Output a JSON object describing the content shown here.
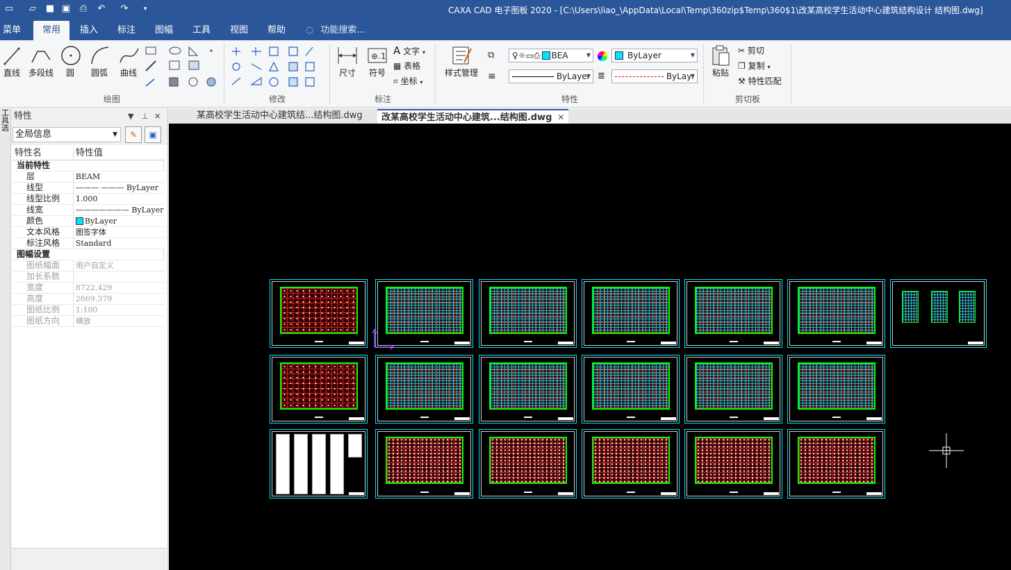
{
  "titlebar": {
    "title": "CAXA CAD 电子图板 2020 - [C:\\Users\\liao_\\AppData\\Local\\Temp\\360zip$Temp\\360$1\\改某高校学生活动中心建筑结构设计 结构图.dwg]"
  },
  "ribbon_tabs": [
    "菜单",
    "常用",
    "插入",
    "标注",
    "图幅",
    "工具",
    "视图",
    "帮助"
  ],
  "search_placeholder": "功能搜索...",
  "draw_group": {
    "label": "绘图",
    "buttons": [
      "直线",
      "多段线",
      "圆",
      "圆弧",
      "曲线"
    ]
  },
  "modify_group": {
    "label": "修改"
  },
  "annotate_group": {
    "label": "标注",
    "dimension": "尺寸",
    "symbol": "符号",
    "text": "文字",
    "table": "表格",
    "coord": "坐标"
  },
  "properties_group": {
    "label": "特性",
    "style_manager": "样式管理",
    "layer_value": "BEA",
    "color_value": "ByLayer",
    "linetype_value": "ByLayer",
    "linewidth_value": "ByLayı"
  },
  "clipboard_group": {
    "label": "剪切板",
    "paste": "粘贴",
    "cut": "剪切",
    "copy": "复制",
    "match": "特性匹配"
  },
  "left_strip": [
    "工",
    "具",
    "选",
    "项",
    "图",
    "层"
  ],
  "props_panel": {
    "title": "特性",
    "scope": "全局信息",
    "col_name": "特性名",
    "col_value": "特性值",
    "rows": [
      {
        "kind": "cat",
        "k": "当前特性",
        "v": ""
      },
      {
        "kind": "row",
        "k": "层",
        "v": "BEAM"
      },
      {
        "kind": "row",
        "k": "线型",
        "v": "——— ——— ByLayer"
      },
      {
        "kind": "row",
        "k": "线型比例",
        "v": "1.000"
      },
      {
        "kind": "row",
        "k": "线宽",
        "v": "——————— ByLayer"
      },
      {
        "kind": "row",
        "k": "颜色",
        "v": "ByLayer"
      },
      {
        "kind": "row",
        "k": "文本风格",
        "v": "图签字体"
      },
      {
        "kind": "row",
        "k": "标注风格",
        "v": "Standard"
      },
      {
        "kind": "cat",
        "k": "图幅设置",
        "v": ""
      },
      {
        "kind": "dim",
        "k": "图纸幅面",
        "v": "用户自定义"
      },
      {
        "kind": "dim",
        "k": "加长系数",
        "v": ""
      },
      {
        "kind": "dim",
        "k": "宽度",
        "v": "8722.429"
      },
      {
        "kind": "dim",
        "k": "高度",
        "v": "2669.379"
      },
      {
        "kind": "dim",
        "k": "图纸比例",
        "v": "1:100"
      },
      {
        "kind": "dim",
        "k": "图纸方向",
        "v": "横放"
      }
    ]
  },
  "doc_tabs": [
    {
      "label": "某高校学生活动中心建筑结...结构图.dwg",
      "active": false
    },
    {
      "label": "改某高校学生活动中心建筑...结构图.dwg",
      "active": true
    }
  ],
  "colors": {
    "titlebar": "#2b579a",
    "canvas": "#000000",
    "sheet_border": "#00e5ff",
    "plan_outline": "#00ff00",
    "layer_color": "#00e5ff"
  }
}
